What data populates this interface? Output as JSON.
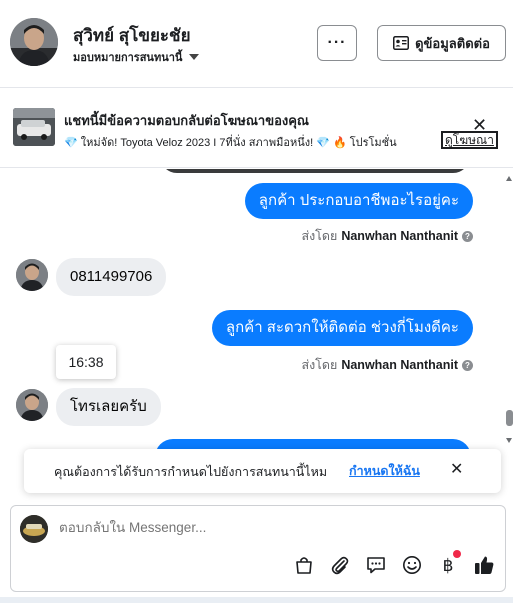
{
  "header": {
    "contact_name": "สุวิทย์ สุโขยะชัย",
    "assign_label": "มอบหมายการสนทนานี้",
    "more_label": "···",
    "contact_info_label": "ดูข้อมูลติดต่อ"
  },
  "ad_banner": {
    "title": "แชทนี้มีข้อความตอบกลับต่อโฆษณาของคุณ",
    "snippet": "💎 ใหม่จัด! Toyota Veloz 2023 I 7ที่นั่ง สภาพมือหนึ่ง! 💎 🔥 โปรโมชั่น",
    "view_ad_label": "ดูโฆษณา",
    "close_label": "✕"
  },
  "messages": [
    {
      "direction": "outgoing",
      "text": "ลูกค้า  ประกอบอาชีพอะไรอยู่คะ",
      "sent_by_prefix": "ส่งโดย",
      "sent_by_name": "Nanwhan Nanthanit"
    },
    {
      "direction": "incoming",
      "text": "0811499706"
    },
    {
      "direction": "outgoing",
      "text": "ลูกค้า สะดวกให้ติดต่อ ช่วงกี่โมงดีคะ",
      "sent_by_prefix": "ส่งโดย",
      "sent_by_name": "Nanwhan Nanthanit"
    },
    {
      "direction": "incoming",
      "text": "โทรเลยครับ"
    }
  ],
  "timestamp_tooltip": "16:38",
  "notification_prompt": {
    "text": "คุณต้องการได้รับการกำหนดไปยังการสนทนานี้ไหม",
    "action_label": "กำหนดให้ฉัน",
    "close_label": "✕"
  },
  "composer": {
    "placeholder": "ตอบกลับใน Messenger...",
    "tools": [
      "shopping-bag-icon",
      "paperclip-icon",
      "saved-replies-icon",
      "emoji-icon",
      "baht-payment-icon",
      "thumbs-up-icon"
    ]
  },
  "colors": {
    "outgoing_bubble": "#0a7cff",
    "incoming_bubble": "#eceef1",
    "link_blue": "#1876f2",
    "notification_dot": "#f02849"
  }
}
